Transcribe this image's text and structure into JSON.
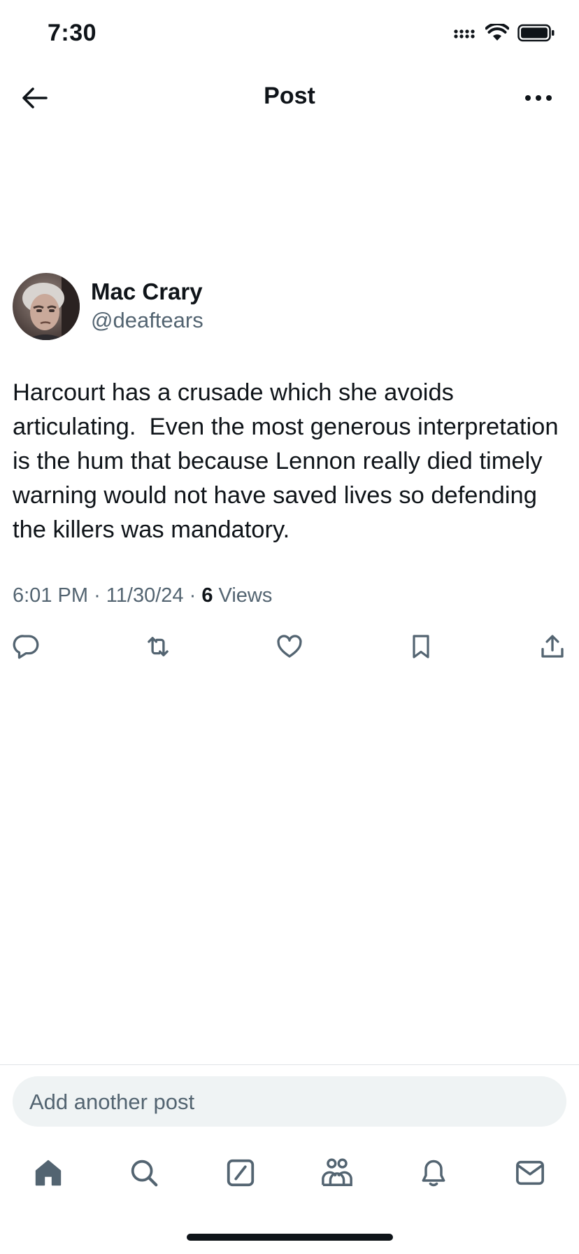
{
  "status_bar": {
    "time": "7:30"
  },
  "header": {
    "title": "Post"
  },
  "post": {
    "author_name": "Mac Crary",
    "author_handle": "@deaftears",
    "text": "Harcourt has a crusade which she avoids articulating.  Even the most generous interpretation is the hum that because Lennon really died timely warning would not have saved lives so defending the killers was mandatory.",
    "time": "6:01 PM",
    "date": "11/30/24",
    "views_count": "6",
    "views_label": "Views",
    "meta_separator": "·"
  },
  "reply": {
    "placeholder": "Add another post"
  },
  "icons": {
    "back": "arrow-left-icon",
    "more": "more-horizontal-icon",
    "actions": [
      "reply-icon",
      "repost-icon",
      "like-icon",
      "bookmark-icon",
      "share-icon"
    ],
    "tabs": [
      "home-icon",
      "search-icon",
      "grok-icon",
      "communities-icon",
      "notifications-icon",
      "messages-icon"
    ]
  },
  "colors": {
    "text": "#0f1419",
    "secondary": "#536471",
    "reply_bg": "#eff3f4",
    "tab_icon": "#536471"
  }
}
